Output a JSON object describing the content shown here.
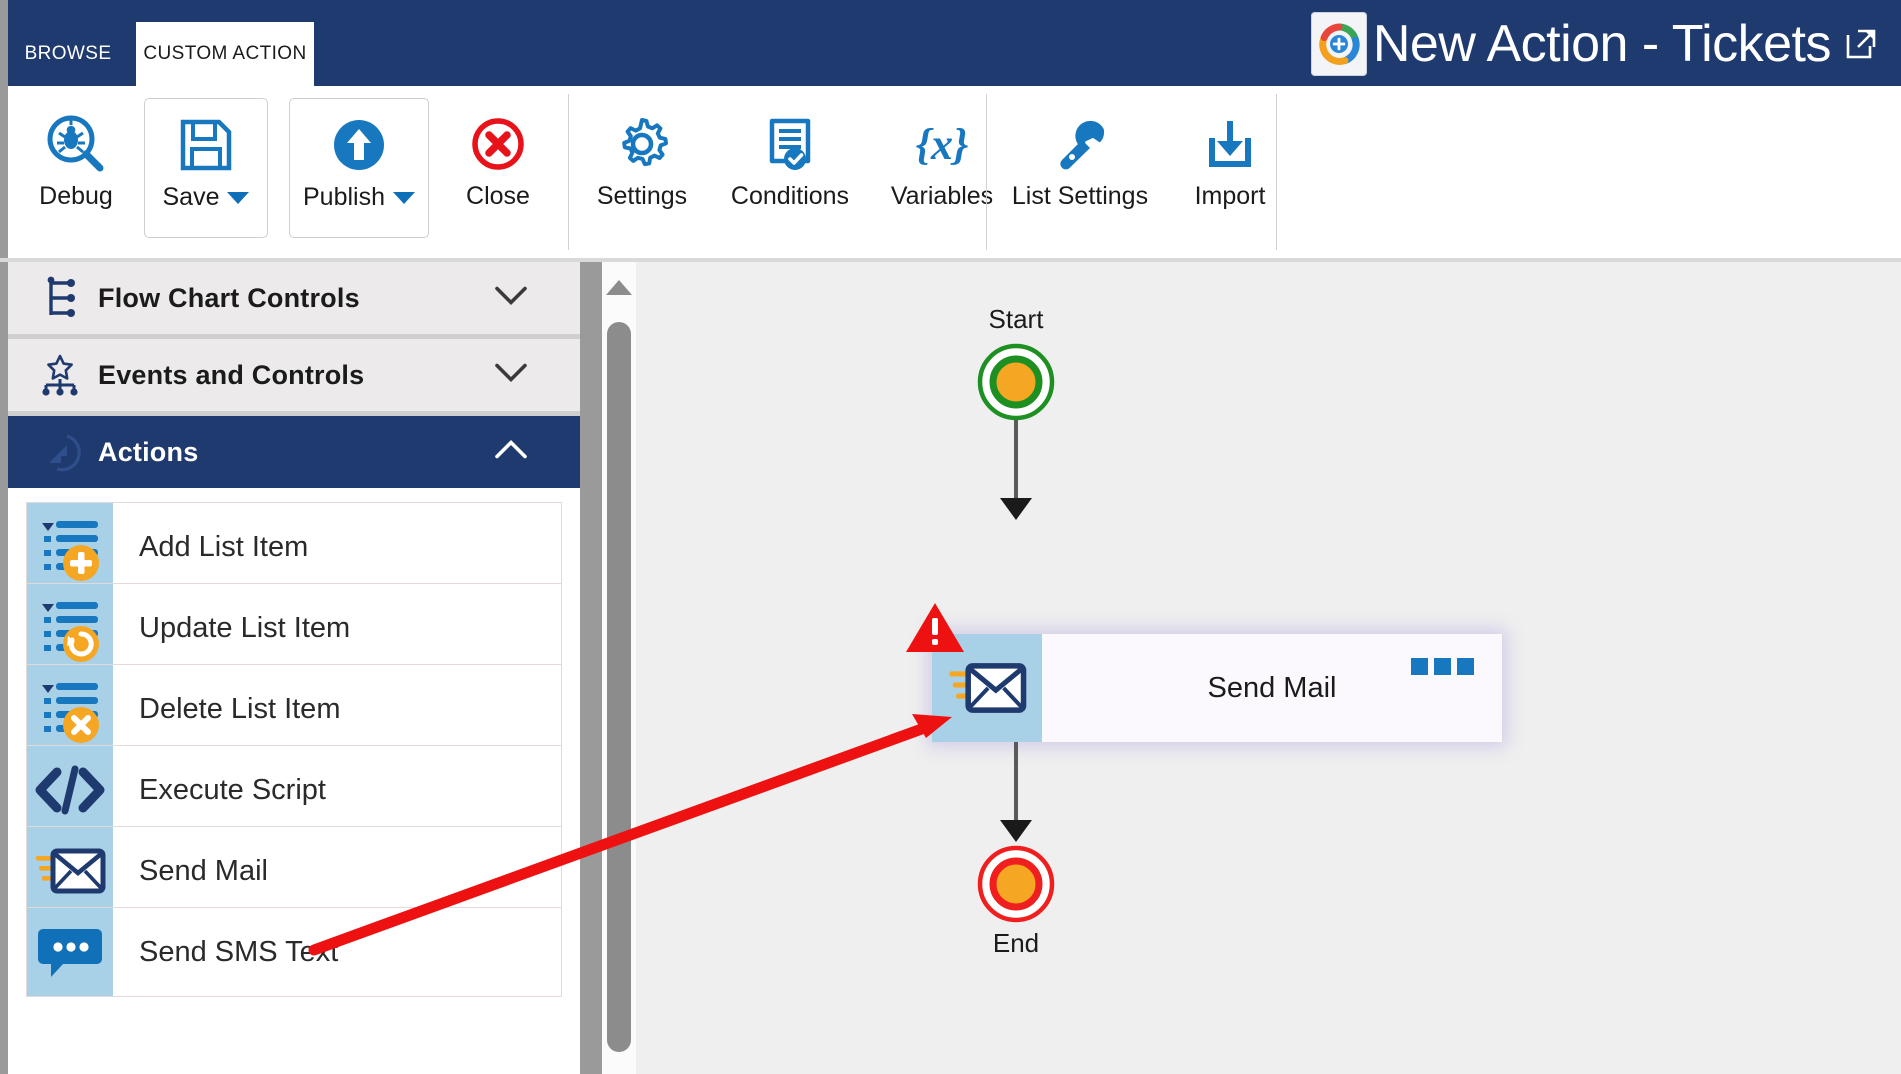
{
  "window": {
    "title": "New Action - Tickets",
    "logo_icon": "app-logo-icon",
    "popout_icon": "open-in-new-window-icon"
  },
  "tabs": [
    {
      "label": "BROWSE",
      "active": false
    },
    {
      "label": "CUSTOM ACTION",
      "active": true
    }
  ],
  "ribbon": {
    "groups": [
      {
        "buttons": [
          {
            "label": "Debug",
            "icon": "debug-bug-magnifier-icon",
            "has_dropdown": false,
            "framed": false
          },
          {
            "label": "Save",
            "icon": "save-floppy-icon",
            "has_dropdown": true,
            "framed": true
          },
          {
            "label": "Publish",
            "icon": "publish-upload-icon",
            "has_dropdown": true,
            "framed": true
          },
          {
            "label": "Close",
            "icon": "close-circle-x-icon",
            "has_dropdown": false,
            "framed": false
          }
        ]
      },
      {
        "buttons": [
          {
            "label": "Settings",
            "icon": "gear-icon",
            "has_dropdown": false,
            "framed": false
          },
          {
            "label": "Conditions",
            "icon": "document-check-icon",
            "has_dropdown": false,
            "framed": false
          },
          {
            "label": "Variables",
            "icon": "variables-braces-x-icon",
            "has_dropdown": false,
            "framed": false
          }
        ]
      },
      {
        "buttons": [
          {
            "label": "List Settings",
            "icon": "wrench-icon",
            "has_dropdown": false,
            "framed": false
          },
          {
            "label": "Import",
            "icon": "import-download-tray-icon",
            "has_dropdown": false,
            "framed": false
          }
        ]
      }
    ]
  },
  "sidebar": {
    "sections": [
      {
        "label": "Flow Chart Controls",
        "icon": "flow-chart-icon",
        "expanded": false,
        "chevron": "chevron-down-icon"
      },
      {
        "label": "Events and Controls",
        "icon": "events-hierarchy-icon",
        "expanded": false,
        "chevron": "chevron-down-icon"
      },
      {
        "label": "Actions",
        "icon": "actions-cursor-icon",
        "expanded": true,
        "chevron": "chevron-up-icon"
      }
    ],
    "actions": [
      {
        "label": "Add List Item",
        "icon": "list-add-icon"
      },
      {
        "label": "Update List Item",
        "icon": "list-update-icon"
      },
      {
        "label": "Delete List Item",
        "icon": "list-delete-icon"
      },
      {
        "label": "Execute Script",
        "icon": "code-brackets-icon"
      },
      {
        "label": "Send Mail",
        "icon": "envelope-icon"
      },
      {
        "label": "Send SMS Text",
        "icon": "sms-bubble-icon"
      }
    ]
  },
  "canvas": {
    "start_label": "Start",
    "end_label": "End",
    "node": {
      "title": "Send Mail",
      "icon": "envelope-icon",
      "menu_icon": "ellipsis-menu-icon",
      "warning_icon": "warning-triangle-icon",
      "selected": true
    },
    "annotation": {
      "type": "arrow",
      "color": "#ee1111",
      "points_to": "send-mail-node-icon"
    }
  },
  "colors": {
    "title_bar": "#1f3a6e",
    "accent_blue": "#1878bf",
    "icon_panel": "#a8d1e8",
    "canvas_bg": "#efefef",
    "warning_red": "#ee1111",
    "start_green": "#1e9022",
    "end_red": "#f01f1f",
    "terminal_center_orange": "#f5a623"
  }
}
